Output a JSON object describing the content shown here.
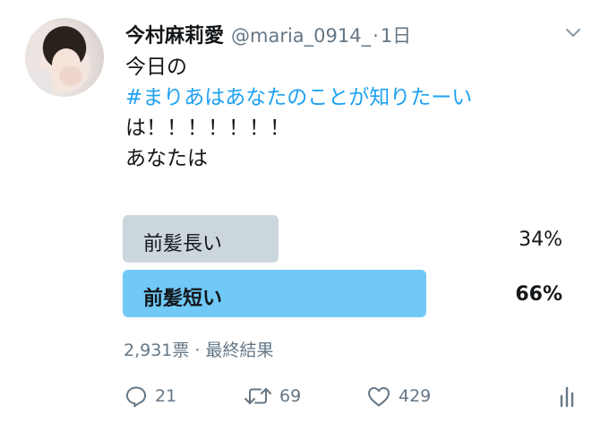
{
  "user": {
    "display_name": "今村麻莉愛",
    "handle": "@maria_0914_",
    "separator": "·",
    "time": "1日"
  },
  "tweet": {
    "line1": "今日の",
    "hashtag": "#まりあはあなたのことが知りたーい",
    "line3": "は！！！！！！！",
    "line4": "あなたは"
  },
  "poll": {
    "options": [
      {
        "label": "前髪長い",
        "percent_text": "34%",
        "percent": 34,
        "winner": false
      },
      {
        "label": "前髪短い",
        "percent_text": "66%",
        "percent": 66,
        "winner": true
      }
    ],
    "meta": "2,931票 · 最終結果"
  },
  "actions": {
    "reply_count": "21",
    "retweet_count": "69",
    "like_count": "429"
  },
  "icons": {
    "reply": "reply-icon",
    "retweet": "retweet-icon",
    "like": "heart-icon",
    "analytics": "analytics-icon",
    "caret": "chevron-down-icon"
  },
  "colors": {
    "accent": "#1da1f2",
    "winner_bar": "#71c9f8",
    "loser_bar": "#ccd6dd",
    "muted_text": "#657786"
  }
}
